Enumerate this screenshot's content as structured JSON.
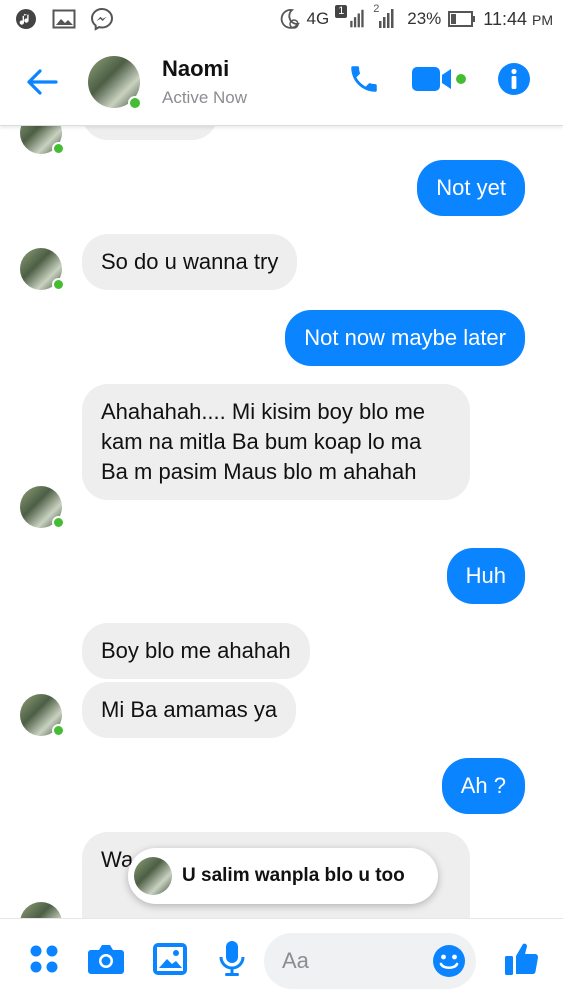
{
  "status_bar": {
    "network": "4G",
    "sim1_badge": "1",
    "sim2_badge": "2",
    "battery": "23%",
    "time": "11:44",
    "ampm": "PM"
  },
  "header": {
    "contact_name": "Naomi",
    "status": "Active Now"
  },
  "messages": [
    {
      "id": "m1",
      "side": "out",
      "text": "Not yet"
    },
    {
      "id": "m2",
      "side": "in",
      "text": "So do u wanna try"
    },
    {
      "id": "m3",
      "side": "out",
      "text": "Not now maybe later"
    },
    {
      "id": "m4",
      "side": "in",
      "text": "Ahahahah.... Mi kisim boy blo me kam na mitla Ba bum koap lo ma Ba m pasim Maus blo m ahahah"
    },
    {
      "id": "m5",
      "side": "out",
      "text": "Huh"
    },
    {
      "id": "m6",
      "side": "in",
      "text": "Boy blo me ahahah"
    },
    {
      "id": "m7",
      "side": "in",
      "text": "Mi Ba amamas ya"
    },
    {
      "id": "m8",
      "side": "out",
      "text": "Ah ?"
    },
    {
      "id": "m9",
      "side": "in",
      "text": "Wa too wantom"
    }
  ],
  "toast": {
    "text": "U salim wanpla blo u too"
  },
  "composer": {
    "placeholder": "Aa"
  },
  "colors": {
    "accent": "#0a84ff",
    "incoming_bubble": "#eeeeef",
    "online": "#44bd32"
  },
  "icons": [
    "back-arrow-icon",
    "phone-icon",
    "video-camera-icon",
    "info-icon",
    "apps-icon",
    "camera-icon",
    "gallery-icon",
    "microphone-icon",
    "emoji-icon",
    "thumbs-up-icon"
  ]
}
